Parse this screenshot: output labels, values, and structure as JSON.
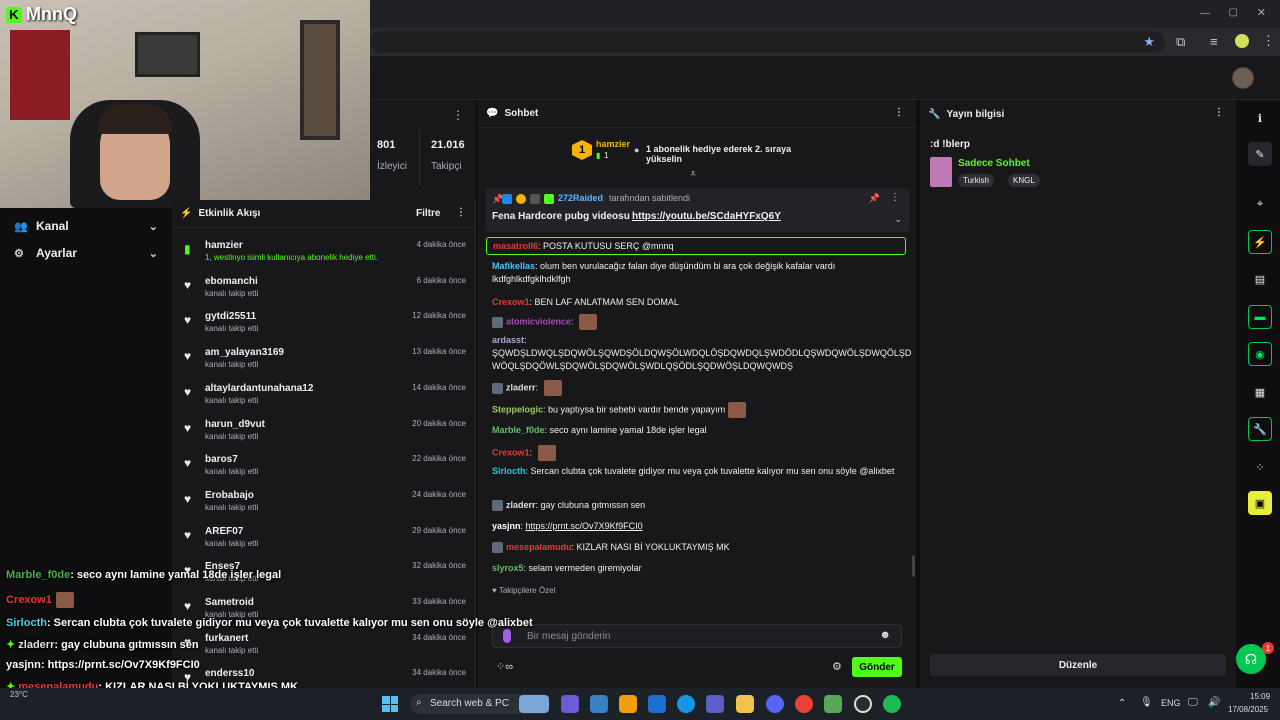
{
  "brand": {
    "logo_letter": "K",
    "channel": "MnnQ"
  },
  "left_nav": [
    {
      "label": "Kanal",
      "icon": "users-icon"
    },
    {
      "label": "Ayarlar",
      "icon": "gear-icon"
    }
  ],
  "stats": {
    "viewers_value": "801",
    "viewers_label": "İzleyici",
    "followers_value": "21.016",
    "followers_label": "Takipçi"
  },
  "activity": {
    "title": "Etkinlik Akışı",
    "filter_label": "Filtre",
    "items": [
      {
        "user": "hamzier",
        "sub": "1, westinyo isimli kullanıcıya abonelik hediye etti.",
        "time": "4 dakika önce",
        "kind": "gift"
      },
      {
        "user": "ebomanchi",
        "sub": "kanalı takip etti",
        "time": "6 dakika önce",
        "kind": "follow"
      },
      {
        "user": "gytdi25511",
        "sub": "kanalı takip etti",
        "time": "12 dakika önce",
        "kind": "follow"
      },
      {
        "user": "am_yalayan3169",
        "sub": "kanalı takip etti",
        "time": "13 dakika önce",
        "kind": "follow"
      },
      {
        "user": "altaylardantunahana12",
        "sub": "kanalı takip etti",
        "time": "14 dakika önce",
        "kind": "follow"
      },
      {
        "user": "harun_d9vut",
        "sub": "kanalı takip etti",
        "time": "20 dakika önce",
        "kind": "follow"
      },
      {
        "user": "baros7",
        "sub": "kanalı takip etti",
        "time": "22 dakika önce",
        "kind": "follow"
      },
      {
        "user": "Erobabajo",
        "sub": "kanalı takip etti",
        "time": "24 dakika önce",
        "kind": "follow"
      },
      {
        "user": "AREF07",
        "sub": "kanalı takip etti",
        "time": "29 dakika önce",
        "kind": "follow"
      },
      {
        "user": "Enses7",
        "sub": "kanalı takip etti",
        "time": "32 dakika önce",
        "kind": "follow"
      },
      {
        "user": "Sametroid",
        "sub": "kanalı takip etti",
        "time": "33 dakika önce",
        "kind": "follow"
      },
      {
        "user": "furkanert",
        "sub": "kanalı takip etti",
        "time": "34 dakika önce",
        "kind": "follow"
      },
      {
        "user": "enderss10",
        "sub": "",
        "time": "34 dakika önce",
        "kind": "follow"
      }
    ]
  },
  "chat": {
    "title": "Sohbet",
    "top_gifter": {
      "rank": "1",
      "user": "hamzier",
      "count": "1",
      "message": "1 abonelik hediye ederek 2. sıraya yükselin"
    },
    "pinned": {
      "by": "272Raided",
      "by_suffix": "tarafından sabitlendi",
      "text": "Fena Hardcore pubg videosu",
      "link": "https://youtu.be/SCdaHYFxQ6Y"
    },
    "highlight": {
      "user": "masatroll6",
      "text": "POSTA KUTUSU SERÇ @mnnq"
    },
    "messages": [
      {
        "user": "Mafikellas",
        "color": "#4fc3f7",
        "text": "olum ben vurulacağız falan diye düşündüm bi ara çok değişik kafalar vardı lkdfghlkdfgklhdklfgh",
        "emote": false
      },
      {
        "user": "Crexow1",
        "color": "#e53935",
        "text": "BEN LAF ANLATMAM SEN DOMAL",
        "emote": false
      },
      {
        "user": "atomicviolence",
        "color": "#ab47bc",
        "text": "",
        "emote": true
      },
      {
        "user": "ardasst",
        "color": "#b39ddb",
        "text": "ŞQWDŞLDWQLŞDQWÖLŞQWDŞÖLDQWŞÖLWDQLÖŞDQWDQLŞWDÖDLQŞWDQWÖLŞDWQÖLŞD WÖQLŞDQÖWLŞDQWÖLŞDQWÖLŞWDLQŞÖDLŞQDWÖŞLDQWQWDŞ",
        "emote": false
      },
      {
        "user": "zladerr",
        "color": "#e0e0e0",
        "text": "",
        "emote": true
      },
      {
        "user": "Steppelogic",
        "color": "#9ccc65",
        "text": "bu yaptıysa bir sebebi vardır bende yapayım",
        "emote": true
      },
      {
        "user": "Marble_f0de",
        "color": "#66bb6a",
        "text": "seco aynı lamine yamal 18de işler legal",
        "emote": false
      },
      {
        "user": "Crexow1",
        "color": "#e53935",
        "text": "",
        "emote": true
      },
      {
        "user": "Sirlocth",
        "color": "#26c6da",
        "text": "Sercan clubta çok tuvalete gidiyor mu veya çok tuvalette kalıyor mu sen onu söyle @alixbet",
        "emote": false
      },
      {
        "user": "zladerr",
        "color": "#e0e0e0",
        "text": "gay clubuna gıtmıssın sen",
        "emote": false
      },
      {
        "user": "yasjnn",
        "color": "#ffffff",
        "text": "https://prnt.sc/Ov7X9Kf9FCI0",
        "emote": false
      },
      {
        "user": "mesepalamudu",
        "color": "#e53935",
        "text": "KIZLAR NASI Bİ YOKLUKTAYMIŞ MK",
        "emote": false
      },
      {
        "user": "slyrox5",
        "color": "#66bb6a",
        "text": "selam vermeden giremiyolar",
        "emote": false
      }
    ],
    "followers_only": "Takipçilere Özel",
    "input_placeholder": "Bir mesaj gönderin",
    "send_label": "Gönder"
  },
  "info": {
    "title": "Yayın bilgisi",
    "stream_title": ":d !blerp",
    "category": "Sadece Sohbet",
    "tags": [
      "Turkish",
      "KNGL"
    ],
    "edit_label": "Düzenle"
  },
  "overlay_chat": [
    {
      "user": "Marble_f0de",
      "color": "#4caf50",
      "text": ": seco aynı lamine yamal 18de işler legal",
      "emote": false
    },
    {
      "user": "Crexow1",
      "color": "#e53935",
      "text": "",
      "emote": true
    },
    {
      "user": "Sirlocth",
      "color": "#4dd0e1",
      "text": ": Sercan clubta çok tuvalete gidiyor mu veya çok tuvalette kalıyor mu sen onu söyle @alixbet",
      "emote": false
    },
    {
      "user": "zladerr",
      "color": "#e0e0e0",
      "text": ": gay clubuna gıtmıssın sen",
      "emote": false
    },
    {
      "user": "yasjnn",
      "color": "#ffffff",
      "text": ": https://prnt.sc/Ov7X9Kf9FCI0",
      "emote": false
    },
    {
      "user": "mesepalamudu",
      "color": "#e53935",
      "text": ": KIZLAR NASI Bİ YOKLUKTAYMIŞ MK",
      "emote": false
    },
    {
      "user": "slyrox5",
      "color": "#66bb6a",
      "text": ": selam vermeden giremiyolar",
      "emote": false
    }
  ],
  "taskbar": {
    "search_label": "Search web & PC",
    "weather": "23°C",
    "lang": "ENG",
    "time": "15:09",
    "date": "17/08/2025",
    "notif_count": "1"
  }
}
